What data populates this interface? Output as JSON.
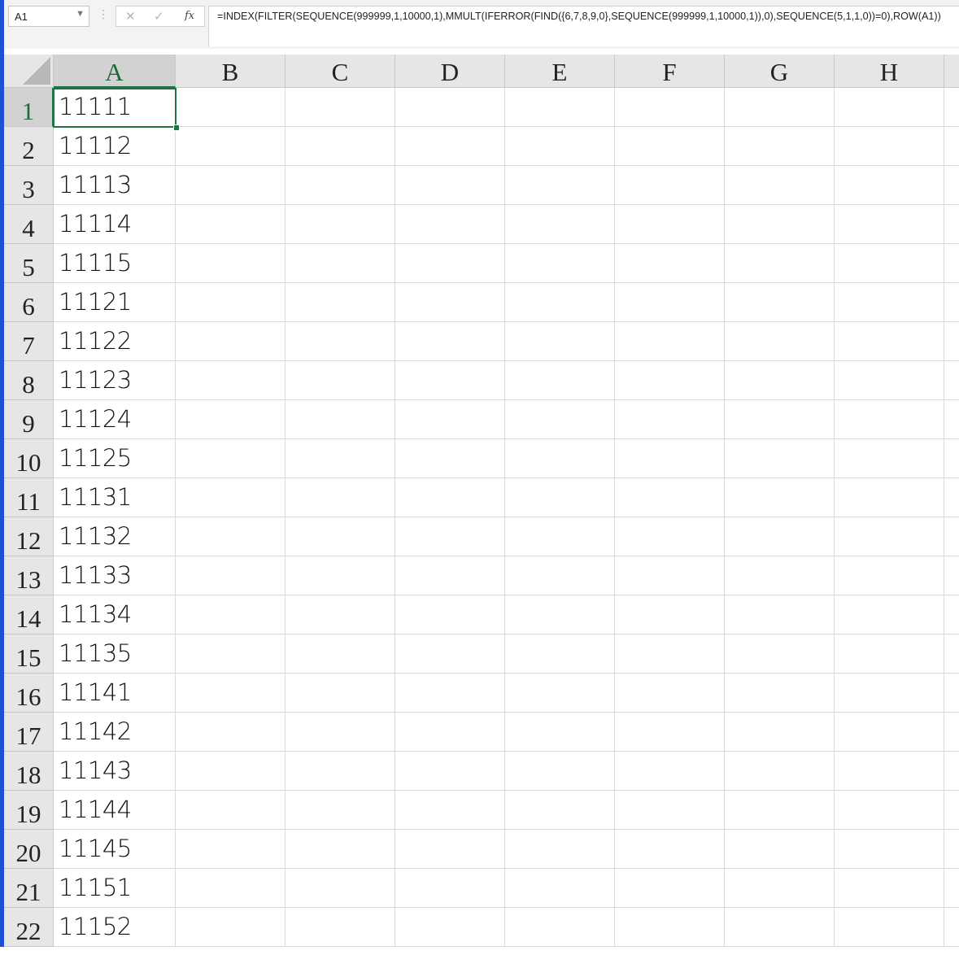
{
  "name_box": {
    "value": "A1"
  },
  "formula_bar": {
    "fx_label": "fx",
    "formula": "=INDEX(FILTER(SEQUENCE(999999,1,10000,1),MMULT(IFERROR(FIND({6,7,8,9,0},SEQUENCE(999999,1,10000,1)),0),SEQUENCE(5,1,1,0))=0),ROW(A1))"
  },
  "selected_cell": "A1",
  "columns": [
    "A",
    "B",
    "C",
    "D",
    "E",
    "F",
    "G",
    "H"
  ],
  "rows": [
    {
      "num": "1",
      "a": "11111"
    },
    {
      "num": "2",
      "a": "11112"
    },
    {
      "num": "3",
      "a": "11113"
    },
    {
      "num": "4",
      "a": "11114"
    },
    {
      "num": "5",
      "a": "11115"
    },
    {
      "num": "6",
      "a": "11121"
    },
    {
      "num": "7",
      "a": "11122"
    },
    {
      "num": "8",
      "a": "11123"
    },
    {
      "num": "9",
      "a": "11124"
    },
    {
      "num": "10",
      "a": "11125"
    },
    {
      "num": "11",
      "a": "11131"
    },
    {
      "num": "12",
      "a": "11132"
    },
    {
      "num": "13",
      "a": "11133"
    },
    {
      "num": "14",
      "a": "11134"
    },
    {
      "num": "15",
      "a": "11135"
    },
    {
      "num": "16",
      "a": "11141"
    },
    {
      "num": "17",
      "a": "11142"
    },
    {
      "num": "18",
      "a": "11143"
    },
    {
      "num": "19",
      "a": "11144"
    },
    {
      "num": "20",
      "a": "11145"
    },
    {
      "num": "21",
      "a": "11151"
    },
    {
      "num": "22",
      "a": "11152"
    }
  ]
}
